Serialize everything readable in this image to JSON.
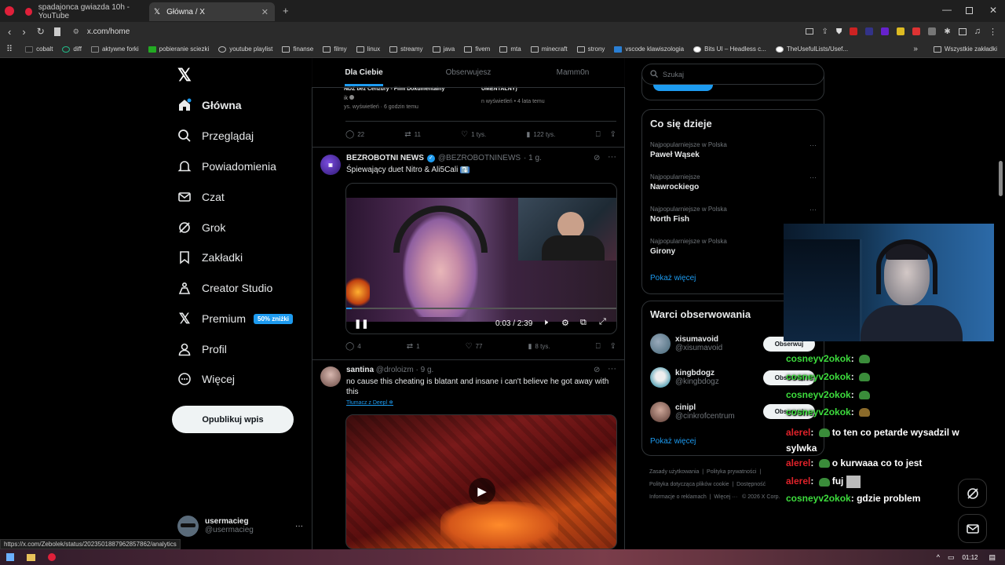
{
  "browser": {
    "tabs": [
      {
        "title": "spadajonca gwiazda 10h - YouTube",
        "active": false
      },
      {
        "title": "Główna / X",
        "active": true
      }
    ],
    "url": "x.com/home",
    "bookmarks": [
      "cobalt",
      "diff",
      "aktywne forki",
      "pobieranie sciezki",
      "youtube playlist",
      "finanse",
      "filmy",
      "linux",
      "streamy",
      "java",
      "fivem",
      "mta",
      "minecraft",
      "strony",
      "vscode klawiszologia",
      "Bits UI – Headless c...",
      "TheUsefulLists/Usef...",
      "Wszystkie zakładki"
    ],
    "more": "»"
  },
  "nav": {
    "items": [
      "Główna",
      "Przeglądaj",
      "Powiadomienia",
      "Czat",
      "Grok",
      "Zakładki",
      "Creator Studio",
      "Premium",
      "Profil",
      "Więcej"
    ],
    "premium_badge": "50% zniżki",
    "post_button": "Opublikuj wpis",
    "user_name": "usermacieg",
    "user_handle": "@usermacieg",
    "user_more": "···"
  },
  "feed": {
    "tabs": [
      "Dla Ciebie",
      "Obserwujesz",
      "Mamm0n"
    ],
    "top_post": {
      "left_title": "NDZ bez Cenzury - Film Dokumentalny",
      "left_author": "ik",
      "left_meta": "ys. wyświetleń · 6 godzin temu",
      "right_title": "UMENTALNY)",
      "right_meta": "n wyświetleń • 4 lata temu",
      "replies": "22",
      "reposts": "11",
      "likes": "1 tys.",
      "views": "122 tys."
    },
    "post1": {
      "name": "BEZROBOTNI NEWS",
      "handle": "@BEZROBOTNINEWS",
      "time": "· 1 g.",
      "text": "Śpiewający duet Nitro & Ali5Cali",
      "emoji": "⤵️",
      "video_time": "0:03 / 2:39",
      "video_progress": 0.019,
      "replies": "4",
      "reposts": "1",
      "likes": "77",
      "views": "8 tys."
    },
    "post2": {
      "name": "santina",
      "handle": "@droloizm",
      "time": "· 9 g.",
      "text": "no cause this cheating is blatant and insane i can't believe he got away with this",
      "translate": "Tłumacz z Deepl"
    }
  },
  "right": {
    "search_placeholder": "Szukaj",
    "trends_title": "Co się dzieje",
    "trends": [
      {
        "context": "Najpopularniejsze w Polska",
        "name": "Paweł Wąsek"
      },
      {
        "context": "Najpopularniejsze",
        "name": "Nawrockiego"
      },
      {
        "context": "Najpopularniejsze w Polska",
        "name": "North Fish"
      },
      {
        "context": "Najpopularniejsze w Polska",
        "name": "Girony"
      }
    ],
    "show_more": "Pokaż więcej",
    "follow_title": "Warci obserwowania",
    "follow": [
      {
        "name": "xisumavoid",
        "handle": "@xisumavoid"
      },
      {
        "name": "kingbdogz",
        "handle": "@kingbdogz"
      },
      {
        "name": "cinipl",
        "handle": "@cinkrofcentrum"
      }
    ],
    "follow_button": "Obserwuj",
    "footer": [
      "Zasady użytkowania",
      "Polityka prywatności",
      "Polityka dotycząca plików cookie",
      "Dostępność",
      "Informacje o reklamach",
      "Więcej ···",
      "© 2026 X Corp."
    ]
  },
  "chat": [
    {
      "user": "cosneyv2okok",
      "color": "green",
      "text": ""
    },
    {
      "user": "cosneyv2okok",
      "color": "green",
      "text": ""
    },
    {
      "user": "cosneyv2okok",
      "color": "green",
      "text": ""
    },
    {
      "user": "cosneyv2okok",
      "color": "green",
      "text": ""
    },
    {
      "user": "alerel",
      "color": "red",
      "text": "to ten co petarde wysadzil w sylwka"
    },
    {
      "user": "alerel",
      "color": "red",
      "text": "o kurwaaa co to jest"
    },
    {
      "user": "alerel",
      "color": "red",
      "text": "fuj"
    },
    {
      "user": "cosneyv2okok",
      "color": "green",
      "text": "gdzie problem"
    }
  ],
  "status_url": "https://x.com/Zebolek/status/2023501887962857862/analytics",
  "taskbar": {
    "time": "01:12"
  }
}
